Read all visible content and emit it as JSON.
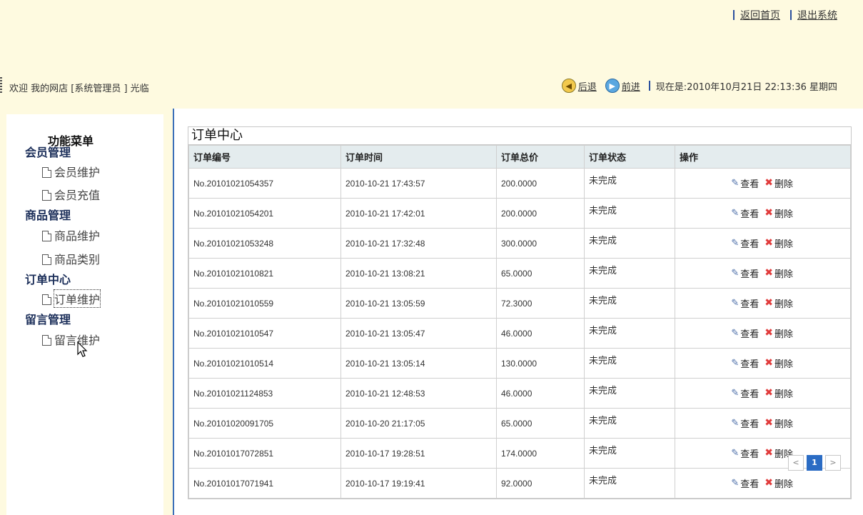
{
  "header": {
    "links": [
      {
        "label": "返回首页"
      },
      {
        "label": "退出系统"
      }
    ],
    "welcome": "欢迎  我的网店  [系统管理员  ] 光临",
    "back_label": "后退",
    "forward_label": "前进",
    "datetime": "现在是:2010年10月21日 22:13:36 星期四"
  },
  "sidebar": {
    "title": "功能菜单",
    "groups": [
      {
        "label": "会员管理",
        "items": [
          {
            "label": "会员维护"
          },
          {
            "label": "会员充值"
          }
        ]
      },
      {
        "label": "商品管理",
        "items": [
          {
            "label": "商品维护"
          },
          {
            "label": "商品类别"
          }
        ]
      },
      {
        "label": "订单中心",
        "items": [
          {
            "label": "订单维护"
          }
        ]
      },
      {
        "label": "留言管理",
        "items": [
          {
            "label": "留言维护"
          }
        ]
      }
    ]
  },
  "panel": {
    "title": "订单中心",
    "columns": [
      "订单编号",
      "订单时间",
      "订单总价",
      "订单状态",
      "操作"
    ],
    "view_label": "查看",
    "delete_label": "删除",
    "rows": [
      {
        "id": "No.20101021054357",
        "time": "2010-10-21 17:43:57",
        "total": "200.0000",
        "status": "未完成"
      },
      {
        "id": "No.20101021054201",
        "time": "2010-10-21 17:42:01",
        "total": "200.0000",
        "status": "未完成"
      },
      {
        "id": "No.20101021053248",
        "time": "2010-10-21 17:32:48",
        "total": "300.0000",
        "status": "未完成"
      },
      {
        "id": "No.20101021010821",
        "time": "2010-10-21 13:08:21",
        "total": "65.0000",
        "status": "未完成"
      },
      {
        "id": "No.20101021010559",
        "time": "2010-10-21 13:05:59",
        "total": "72.3000",
        "status": "未完成"
      },
      {
        "id": "No.20101021010547",
        "time": "2010-10-21 13:05:47",
        "total": "46.0000",
        "status": "未完成"
      },
      {
        "id": "No.20101021010514",
        "time": "2010-10-21 13:05:14",
        "total": "130.0000",
        "status": "未完成"
      },
      {
        "id": "No.20101021124853",
        "time": "2010-10-21 12:48:53",
        "total": "46.0000",
        "status": "未完成"
      },
      {
        "id": "No.20101020091705",
        "time": "2010-10-20 21:17:05",
        "total": "65.0000",
        "status": "未完成"
      },
      {
        "id": "No.20101017072851",
        "time": "2010-10-17 19:28:51",
        "total": "174.0000",
        "status": "未完成"
      },
      {
        "id": "No.20101017071941",
        "time": "2010-10-17 19:19:41",
        "total": "92.0000",
        "status": "未完成"
      }
    ]
  },
  "pager": {
    "prev": "<",
    "current": "1",
    "next": ">"
  }
}
